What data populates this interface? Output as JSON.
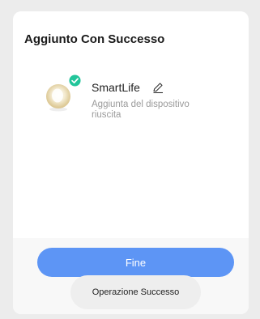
{
  "dialog": {
    "title": "Aggiunto Con Successo"
  },
  "device": {
    "name": "SmartLife",
    "status": "Aggiunta del dispositivo riuscita",
    "icon": "lamp-icon",
    "badge_icon": "check-badge-icon",
    "edit_icon": "edit-pencil-icon"
  },
  "actions": {
    "done_label": "Fine"
  },
  "toast": {
    "message": "Operazione Successo"
  },
  "colors": {
    "accent": "#5d95f5",
    "success": "#22c59a",
    "background": "#ececec",
    "card": "#ffffff"
  }
}
